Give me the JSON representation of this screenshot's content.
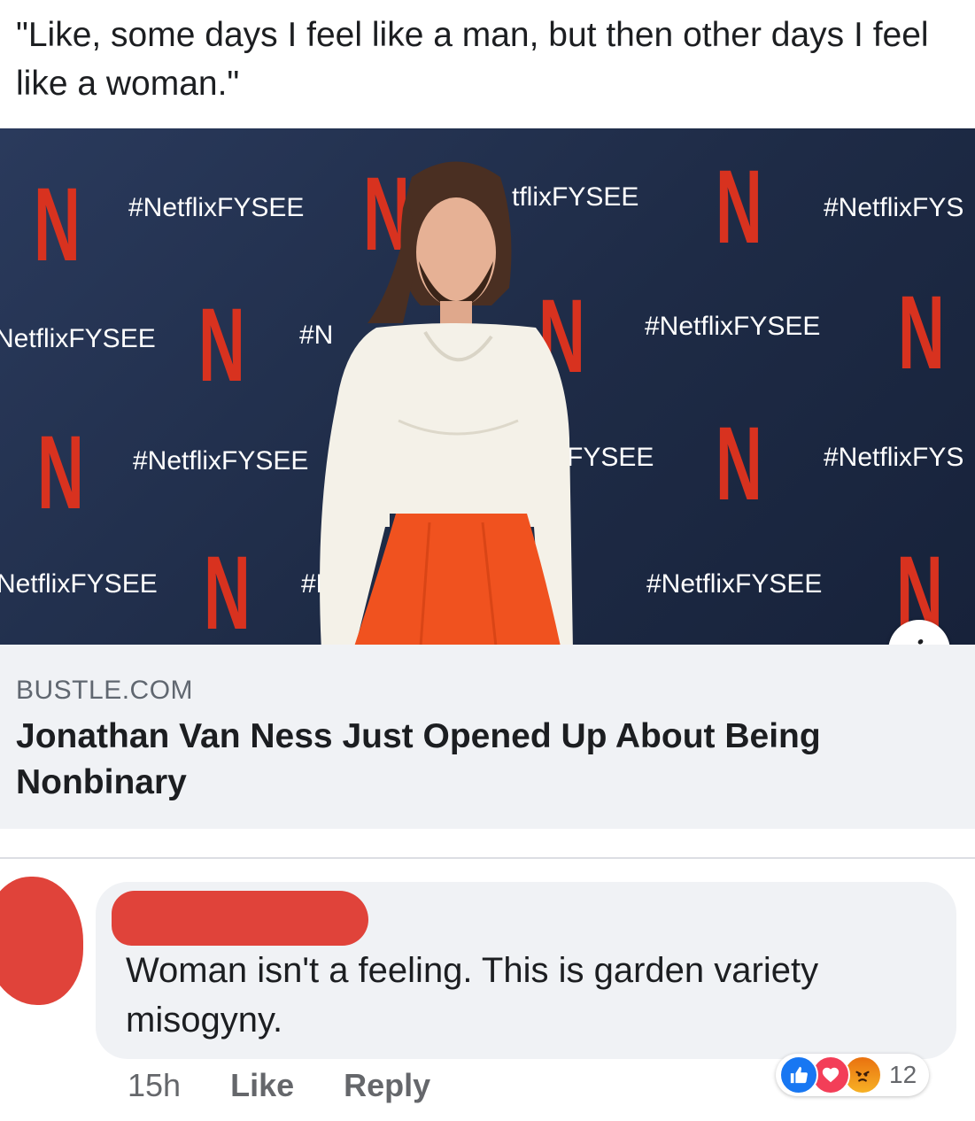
{
  "post": {
    "text": "\"Like, some days I feel like a man, but then other days I feel like a woman.\""
  },
  "preview": {
    "hashtags": [
      "#NetflixFYSEE",
      "tflixFYSEE",
      "#NetflixFYS",
      "NetflixFYSEE",
      "#N",
      "#NetflixFYSEE",
      "#NetflixFYSEE",
      "FYSEE",
      "#NetflixFYS",
      "NetflixFYSEE",
      "#Ne",
      "#NetflixFYSEE"
    ],
    "logo_letter": "N",
    "info_icon": "i",
    "domain": "BUSTLE.COM",
    "headline": "Jonathan Van Ness Just Opened Up About Being Nonbinary"
  },
  "comment": {
    "text": "Woman isn't a feeling. This is garden variety misogyny.",
    "time": "15h",
    "like_label": "Like",
    "reply_label": "Reply",
    "reactions": [
      "like-icon",
      "love-icon",
      "angry-icon"
    ],
    "reaction_count": "12"
  },
  "colors": {
    "netflix_red": "#d8321f",
    "backdrop": "#1e2b46",
    "redaction": "#e0433a",
    "bubble": "#f0f2f5"
  }
}
